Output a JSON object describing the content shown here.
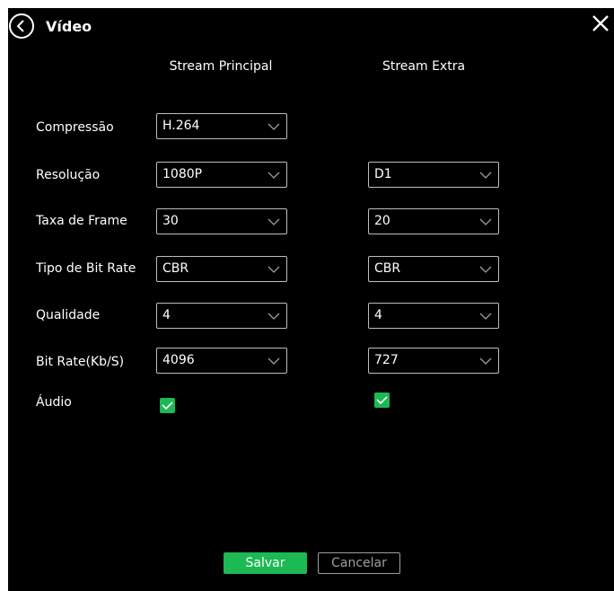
{
  "dialog": {
    "title": "Vídeo",
    "back_icon": "back-circle-icon",
    "close_icon": "close-icon"
  },
  "columns": {
    "principal": "Stream Principal",
    "extra": "Stream Extra"
  },
  "rows": {
    "compressao": {
      "label": "Compressão",
      "principal": "H.264"
    },
    "resolucao": {
      "label": "Resolução",
      "principal": "1080P",
      "extra": "D1"
    },
    "taxa_frame": {
      "label": "Taxa de Frame",
      "principal": "30",
      "extra": "20"
    },
    "tipo_bitrate": {
      "label": "Tipo de Bit Rate",
      "principal": "CBR",
      "extra": "CBR"
    },
    "qualidade": {
      "label": "Qualidade",
      "principal": "4",
      "extra": "4"
    },
    "bitrate": {
      "label": "Bit Rate(Kb/S)",
      "principal": "4096",
      "extra": "727"
    },
    "audio": {
      "label": "Áudio",
      "principal_checked": true,
      "extra_checked": true
    }
  },
  "buttons": {
    "save": "Salvar",
    "cancel": "Cancelar"
  },
  "colors": {
    "background": "#000000",
    "accent": "#1db954",
    "border": "#bdbdbd"
  }
}
